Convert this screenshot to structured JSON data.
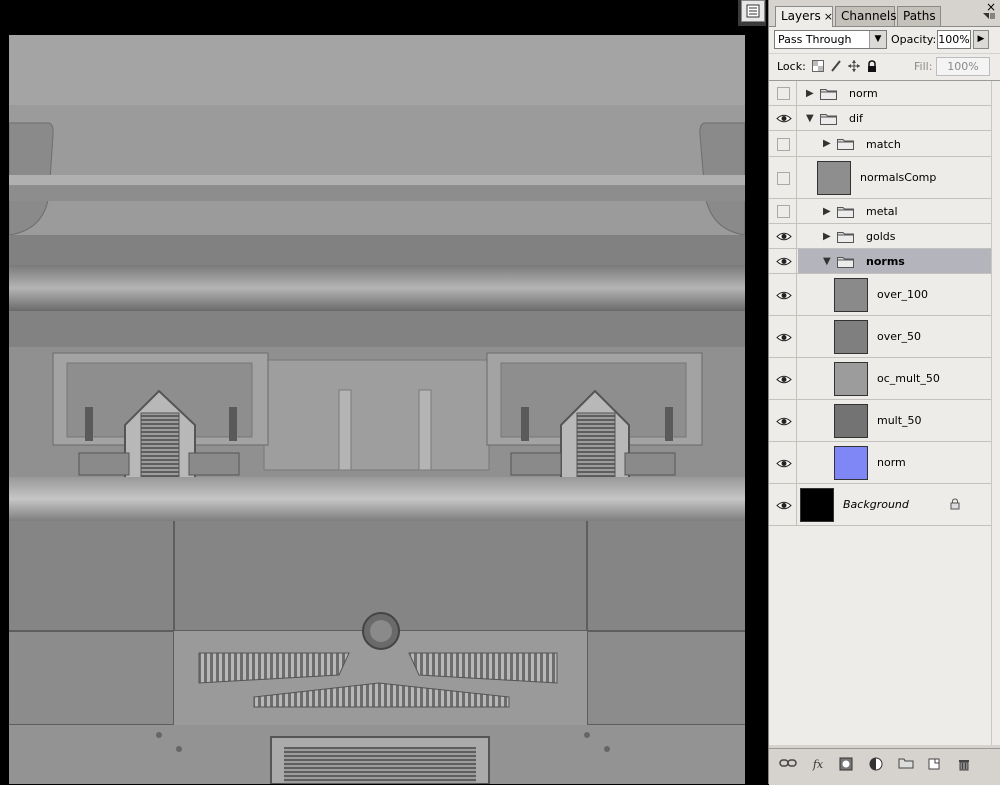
{
  "panel": {
    "tabs": [
      {
        "label": "Layers",
        "active": true
      },
      {
        "label": "Channels",
        "active": false
      },
      {
        "label": "Paths",
        "active": false
      }
    ],
    "blend_mode": "Pass Through",
    "opacity_label": "Opacity:",
    "opacity_value": "100%",
    "lock_label": "Lock:",
    "fill_label": "Fill:",
    "fill_value": "100%",
    "close_symbol": "×",
    "layers": [
      {
        "name": "norm",
        "kind": "group",
        "visible": false,
        "expanded": false,
        "indent": 0
      },
      {
        "name": "dif",
        "kind": "group",
        "visible": true,
        "expanded": true,
        "indent": 0
      },
      {
        "name": "match",
        "kind": "group",
        "visible": false,
        "expanded": false,
        "indent": 1
      },
      {
        "name": "normalsComp",
        "kind": "layer",
        "visible": false,
        "indent": 1,
        "thumb": "#8e8e8e"
      },
      {
        "name": "metal",
        "kind": "group",
        "visible": false,
        "expanded": false,
        "indent": 1
      },
      {
        "name": "golds",
        "kind": "group",
        "visible": true,
        "expanded": false,
        "indent": 1
      },
      {
        "name": "norms",
        "kind": "group",
        "visible": true,
        "expanded": true,
        "indent": 1,
        "selected": true
      },
      {
        "name": "over_100",
        "kind": "layer",
        "visible": true,
        "indent": 2,
        "thumb": "#8a8a8a"
      },
      {
        "name": "over_50",
        "kind": "layer",
        "visible": true,
        "indent": 2,
        "thumb": "#7f7f7f"
      },
      {
        "name": "oc_mult_50",
        "kind": "layer",
        "visible": true,
        "indent": 2,
        "thumb": "#9c9c9c"
      },
      {
        "name": "mult_50",
        "kind": "layer",
        "visible": true,
        "indent": 2,
        "thumb": "#737373"
      },
      {
        "name": "norm",
        "kind": "layer",
        "visible": true,
        "indent": 2,
        "thumb": "#7f86f6"
      },
      {
        "name": "Background",
        "kind": "background",
        "visible": true,
        "indent": 0,
        "thumb": "#000000",
        "locked": true
      }
    ]
  },
  "colors": {
    "panel_bg": "#d6d3ce",
    "list_bg": "#eeece8",
    "selected_row": "#b4b4bc",
    "canvas_gray": "#8f8f8f"
  },
  "icons": {
    "lock_options": [
      "lock-transparency-icon",
      "lock-paint-icon",
      "lock-move-icon",
      "lock-all-icon"
    ],
    "footer": [
      "link-layers-icon",
      "fx-icon",
      "mask-icon",
      "adjustment-icon",
      "new-group-icon",
      "new-layer-icon",
      "trash-icon"
    ]
  }
}
